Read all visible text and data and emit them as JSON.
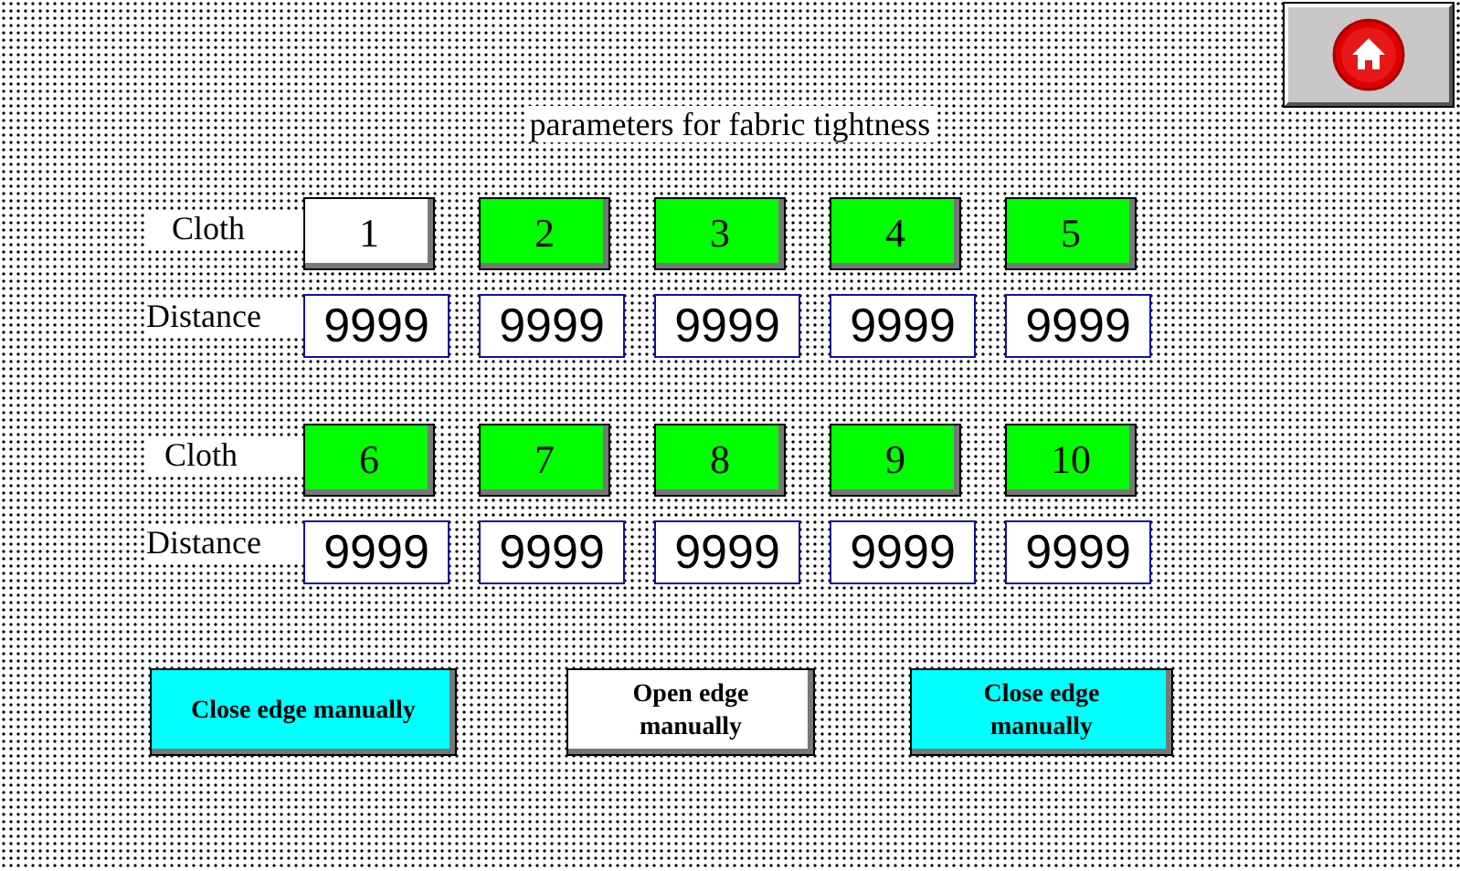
{
  "title": "parameters for fabric tightness",
  "groups": [
    {
      "cloth_label": "Cloth",
      "distance_label": "Distance",
      "items": [
        {
          "cloth": "1",
          "selected": true,
          "distance": "9999"
        },
        {
          "cloth": "2",
          "selected": false,
          "distance": "9999"
        },
        {
          "cloth": "3",
          "selected": false,
          "distance": "9999"
        },
        {
          "cloth": "4",
          "selected": false,
          "distance": "9999"
        },
        {
          "cloth": "5",
          "selected": false,
          "distance": "9999"
        }
      ]
    },
    {
      "cloth_label": "Cloth",
      "distance_label": "Distance",
      "items": [
        {
          "cloth": "6",
          "selected": false,
          "distance": "9999"
        },
        {
          "cloth": "7",
          "selected": false,
          "distance": "9999"
        },
        {
          "cloth": "8",
          "selected": false,
          "distance": "9999"
        },
        {
          "cloth": "9",
          "selected": false,
          "distance": "9999"
        },
        {
          "cloth": "10",
          "selected": false,
          "distance": "9999"
        }
      ]
    }
  ],
  "buttons": [
    {
      "label": "Close edge manually",
      "on": true
    },
    {
      "label": "Open edge manually",
      "on": false
    },
    {
      "label": "Close edge manually",
      "on": true
    }
  ]
}
